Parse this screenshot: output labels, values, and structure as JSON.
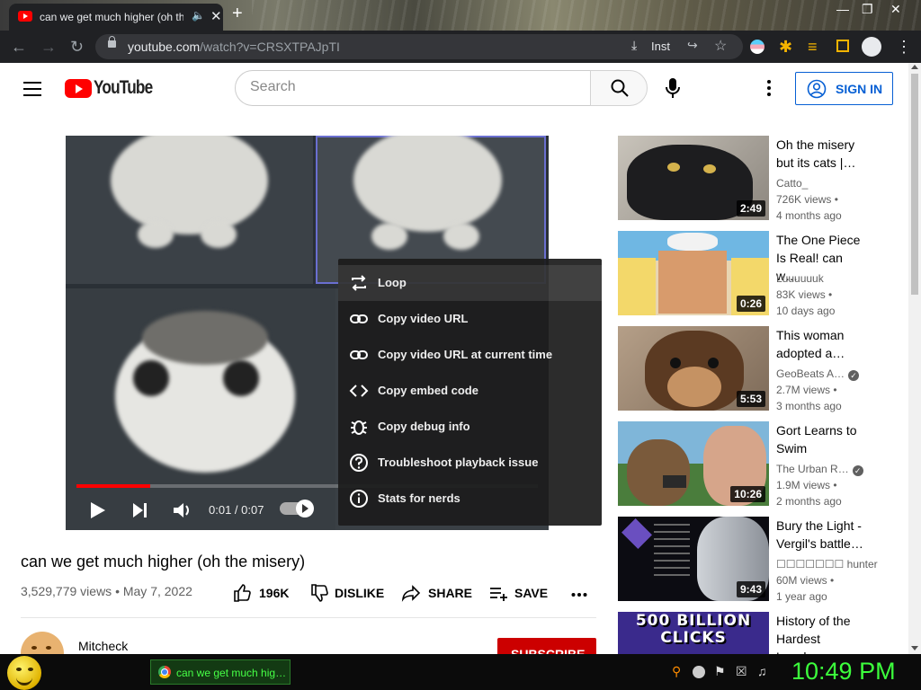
{
  "browser": {
    "tab_title": "can we get much higher (oh the misery)",
    "new_tab_label": "+",
    "url_domain": "youtube.com",
    "url_path": "/watch?v=CRSXTPAJpTI",
    "install_label": "Inst",
    "accent_color": "#202124"
  },
  "youtube": {
    "logo_text": "YouTube",
    "search_placeholder": "Search",
    "signin_label": "SIGN IN",
    "brand_color": "#ff0000",
    "link_color": "#065fd4"
  },
  "player": {
    "time_display": "0:01 / 0:07",
    "progress_fraction": 0.16,
    "context_menu": [
      {
        "label": "Loop",
        "icon": "loop-icon"
      },
      {
        "label": "Copy video URL",
        "icon": "link-icon"
      },
      {
        "label": "Copy video URL at current time",
        "icon": "link-icon"
      },
      {
        "label": "Copy embed code",
        "icon": "code-icon"
      },
      {
        "label": "Copy debug info",
        "icon": "bug-icon"
      },
      {
        "label": "Troubleshoot playback issue",
        "icon": "help-icon"
      },
      {
        "label": "Stats for nerds",
        "icon": "info-icon"
      }
    ]
  },
  "video": {
    "title": "can we get much higher (oh the misery)",
    "stats": "3,529,779 views • May 7, 2022",
    "like_count": "196K",
    "dislike_label": "DISLIKE",
    "share_label": "SHARE",
    "save_label": "SAVE",
    "channel_name": "Mitcheck",
    "subscribe_label": "SUBSCRIBE"
  },
  "related": [
    {
      "title": "Oh the misery but its cats |…",
      "channel": "Catto_",
      "views": "726K views •",
      "age": "4 months ago",
      "duration": "2:49"
    },
    {
      "title": "The One Piece Is Real! can w…",
      "channel": "Luuuuuuk",
      "views": "83K views •",
      "age": "10 days ago",
      "duration": "0:26"
    },
    {
      "title": "This woman adopted a…",
      "channel": "GeoBeats A…",
      "views": "2.7M views •",
      "age": "3 months ago",
      "duration": "5:53"
    },
    {
      "title": "Gort Learns to Swim",
      "channel": "The Urban R…",
      "views": "1.9M views •",
      "age": "2 months ago",
      "duration": "10:26"
    },
    {
      "title": "Bury the Light - Vergil's battle…",
      "channel": "☐☐☐☐☐☐☐ hunter",
      "views": "60M views •",
      "age": "1 year ago",
      "duration": "9:43"
    },
    {
      "title": "History of the Hardest Level…",
      "thumb_text": "500 BILLION CLICKS"
    }
  ],
  "taskbar": {
    "window_label": "can we get much hig…",
    "clock": "10:49 PM",
    "clock_color": "#3cff3c"
  }
}
